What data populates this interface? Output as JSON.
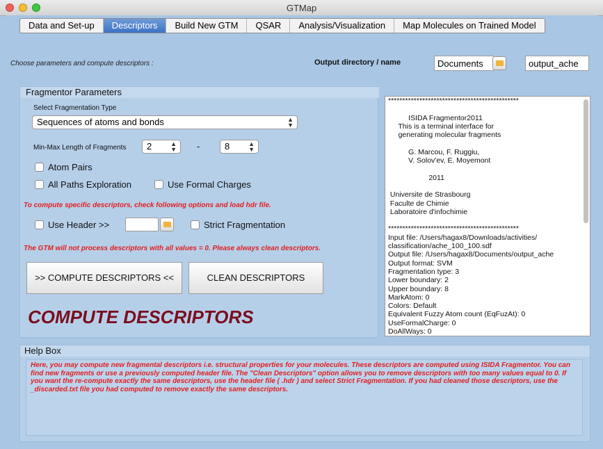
{
  "window": {
    "title": "GTMap"
  },
  "tabs": [
    {
      "label": "Data and Set-up",
      "active": false
    },
    {
      "label": "Descriptors",
      "active": true
    },
    {
      "label": "Build New GTM",
      "active": false
    },
    {
      "label": "QSAR",
      "active": false
    },
    {
      "label": "Analysis/Visualization",
      "active": false
    },
    {
      "label": "Map Molecules on Trained Model",
      "active": false
    }
  ],
  "header": {
    "instruction": "Choose parameters and compute descriptors :",
    "output_label": "Output directory / name",
    "output_dir": "Documents",
    "output_name": "output_ache"
  },
  "fragmentor": {
    "title": "Fragmentor Parameters",
    "select_type_label": "Select Fragmentation Type",
    "fragmentation_type": "Sequences of atoms and bonds",
    "length_label": "Min-Max Length of Fragments",
    "min_length": "2",
    "max_length": "8",
    "dash": "-",
    "atom_pairs": "Atom Pairs",
    "all_paths": "All Paths Exploration",
    "formal_charges": "Use Formal Charges",
    "specific_note": "To compute specific descriptors, check following options and load hdr file.",
    "use_header": "Use Header >>",
    "strict_fragmentation": "Strict Fragmentation",
    "gtm_note": "The GTM will not process descriptors with all values = 0. Please always clean descriptors.",
    "compute_button": ">> COMPUTE DESCRIPTORS <<",
    "clean_button": "CLEAN DESCRIPTORS",
    "big_caption": "COMPUTE DESCRIPTORS"
  },
  "log": {
    "text": "**********************************************\n\n          ISIDA Fragmentor2011\n     This is a terminal interface for\n     generating molecular fragments\n\n          G. Marcou, F. Ruggiu,\n          V. Solov'ev, E. Moyemont\n\n                    2011\n\n Universite de Strasbourg\n Faculte de Chimie\n Laboratoire d'infochimie\n\n**********************************************\nInput file: /Users/hagax8/Downloads/activities/\nclassification/ache_100_100.sdf\nOutput file: /Users/hagax8/Documents/output_ache\nOutput format: SVM\nFragmentation type: 3\nLower boundary: 2\nUpper boundary: 8\nMarkAtom: 0\nColors: Default\nEquivalent Fuzzy Atom count (EqFuzAt): 0\nUseFormalCharge: 0\nDoAllWays: 0"
  },
  "help": {
    "title": "Help Box",
    "text": "Here, you may compute new fragmental descriptors i.e. structural properties for your molecules. These descriptors are computed using ISIDA Fragmentor. You can find new fragments or use a previously computed header file. The \"Clean Descriptors\" option allows you to remove descriptors with too many values equal to 0. If you want the re-compute exactly the same descriptors, use the header file ( .hdr ) and select Strict Fragmentation. If you had cleaned those descriptors, use the _discarded.txt file you had computed to remove exactly the same descriptors."
  },
  "colors": {
    "background": "#a9c6e4",
    "active_tab": "#3d73c4",
    "warning_text": "#e02020",
    "caption": "#7a0e1e"
  }
}
